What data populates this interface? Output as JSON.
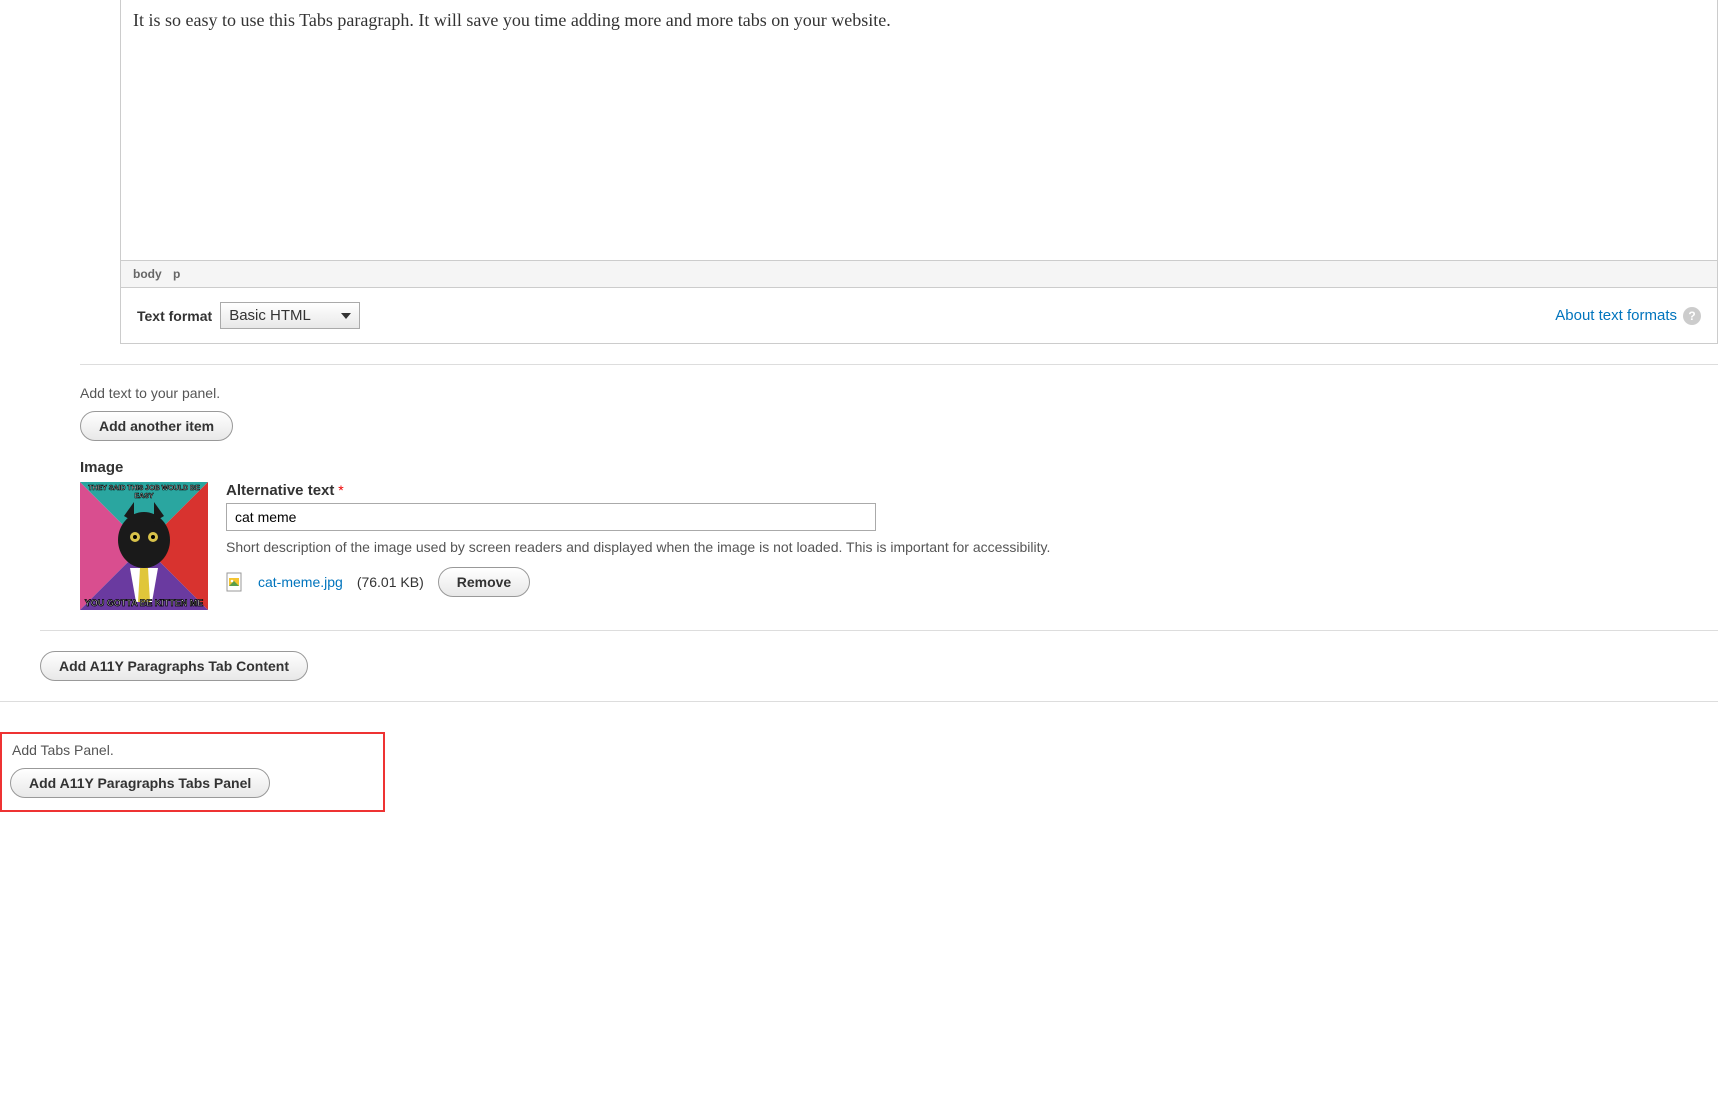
{
  "editor": {
    "content": "It is so easy to use this Tabs paragraph. It will save you time adding more and more tabs on your website.",
    "elements_path": [
      "body",
      "p"
    ]
  },
  "text_format": {
    "label": "Text format",
    "selected": "Basic HTML",
    "about_link": "About text formats"
  },
  "panel_hint": "Add text to your panel.",
  "add_another_item_label": "Add another item",
  "image": {
    "section_label": "Image",
    "alt_label": "Alternative text",
    "alt_value": "cat meme",
    "alt_desc": "Short description of the image used by screen readers and displayed when the image is not loaded. This is important for accessibility.",
    "file_name": "cat-meme.jpg",
    "file_size": "(76.01 KB)",
    "remove_label": "Remove",
    "thumb_top_text": "THEY SAID THIS JOB WOULD BE EASY",
    "thumb_bottom_text": "YOU GOTTA BE KITTEN ME"
  },
  "add_tab_content_label": "Add A11Y Paragraphs Tab Content",
  "tabs_panel": {
    "hint": "Add Tabs Panel.",
    "button_label": "Add A11Y Paragraphs Tabs Panel"
  }
}
